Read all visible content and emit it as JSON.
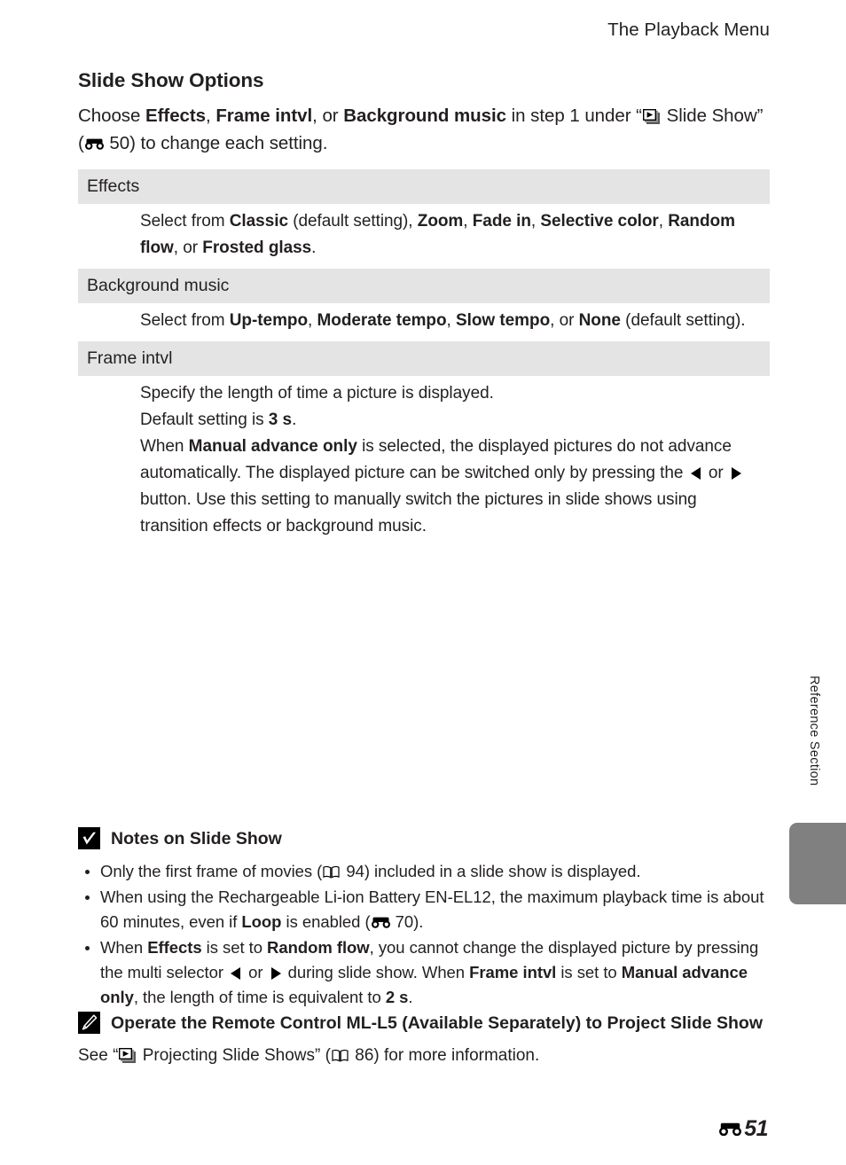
{
  "header": {
    "running_title": "The Playback Menu"
  },
  "section": {
    "title": "Slide Show Options",
    "intro": {
      "part1": "Choose ",
      "bold1": "Effects",
      "part2": ", ",
      "bold2": "Frame intvl",
      "part3": ", or ",
      "bold3": "Background music",
      "part4": " in step 1 under “",
      "icon_slideshow": "slideshow-icon",
      "part5": " Slide Show” (",
      "icon_binoculars": "binoculars-icon",
      "part6": " 50) to change each setting.",
      "ref_page": "50"
    }
  },
  "options_table": {
    "rows": [
      {
        "heading": "Effects",
        "body": {
          "t1": "Select from ",
          "b1": "Classic",
          "t2": " (default setting), ",
          "b2": "Zoom",
          "t3": ", ",
          "b3": "Fade in",
          "t4": ", ",
          "b4": "Selective color",
          "t5": ", ",
          "b5": "Random flow",
          "t6": ", or ",
          "b6": "Frosted glass",
          "t7": "."
        }
      },
      {
        "heading": "Background music",
        "body": {
          "t1": "Select from ",
          "b1": "Up-tempo",
          "t2": ", ",
          "b2": "Moderate tempo",
          "t3": ", ",
          "b3": "Slow tempo",
          "t4": ", or ",
          "b4": "None",
          "t5": " (default setting)."
        }
      },
      {
        "heading": "Frame intvl",
        "body": {
          "line1": "Specify the length of time a picture is displayed.",
          "line2_t1": "Default setting is ",
          "line2_b1": "3 s",
          "line2_t2": ".",
          "line3_t1": "When ",
          "line3_b1": "Manual advance only",
          "line3_t2": " is selected, the displayed pictures do not advance automatically. The displayed picture can be switched only by pressing the ",
          "icon_left": "triangle-left-icon",
          "line3_t3": " or ",
          "icon_right": "triangle-right-icon",
          "line3_t4": " button. Use this setting to manually switch the pictures in slide shows using transition effects or background music."
        }
      }
    ]
  },
  "notes_slide_show": {
    "badge_icon": "check-badge-icon",
    "title": "Notes on Slide Show",
    "bullets": [
      {
        "t1": "Only the first frame of movies (",
        "icon_book": "book-icon",
        "t2": " 94) included in a slide show is displayed.",
        "ref_page": "94"
      },
      {
        "t1": "When using the Rechargeable Li-ion Battery EN-EL12, the maximum playback time is about 60 minutes, even if ",
        "b1": "Loop",
        "t2": " is enabled (",
        "icon_binoculars": "binoculars-icon",
        "t3": " 70).",
        "ref_page": "70"
      },
      {
        "t1": "When ",
        "b1": "Effects",
        "t2": " is set to ",
        "b2": "Random flow",
        "t3": ", you cannot change the displayed picture by pressing the multi selector ",
        "icon_left": "triangle-left-icon",
        "t4": " or ",
        "icon_right": "triangle-right-icon",
        "t5": " during slide show. When ",
        "b3": "Frame intvl",
        "t6": " is set to ",
        "b4": "Manual advance only",
        "t7": ", the length of time is equivalent to ",
        "b5": "2 s",
        "t8": "."
      }
    ]
  },
  "notes_remote": {
    "badge_icon": "pencil-badge-icon",
    "title": "Operate the Remote Control ML-L5 (Available Separately) to Project Slide Show",
    "body": {
      "t1": "See “",
      "icon_slideshow": "slideshow-icon",
      "t2": " Projecting Slide Shows” (",
      "icon_book": "book-icon",
      "t3": " 86) for more information.",
      "ref_page": "86"
    }
  },
  "side_tab": {
    "label": "Reference Section",
    "tab_color": "#808080"
  },
  "footer": {
    "icon_binoculars": "binoculars-icon",
    "folio": "51"
  },
  "colors": {
    "text": "#231f20",
    "table_header_bg": "#e4e4e4",
    "tab_gray": "#808080"
  }
}
